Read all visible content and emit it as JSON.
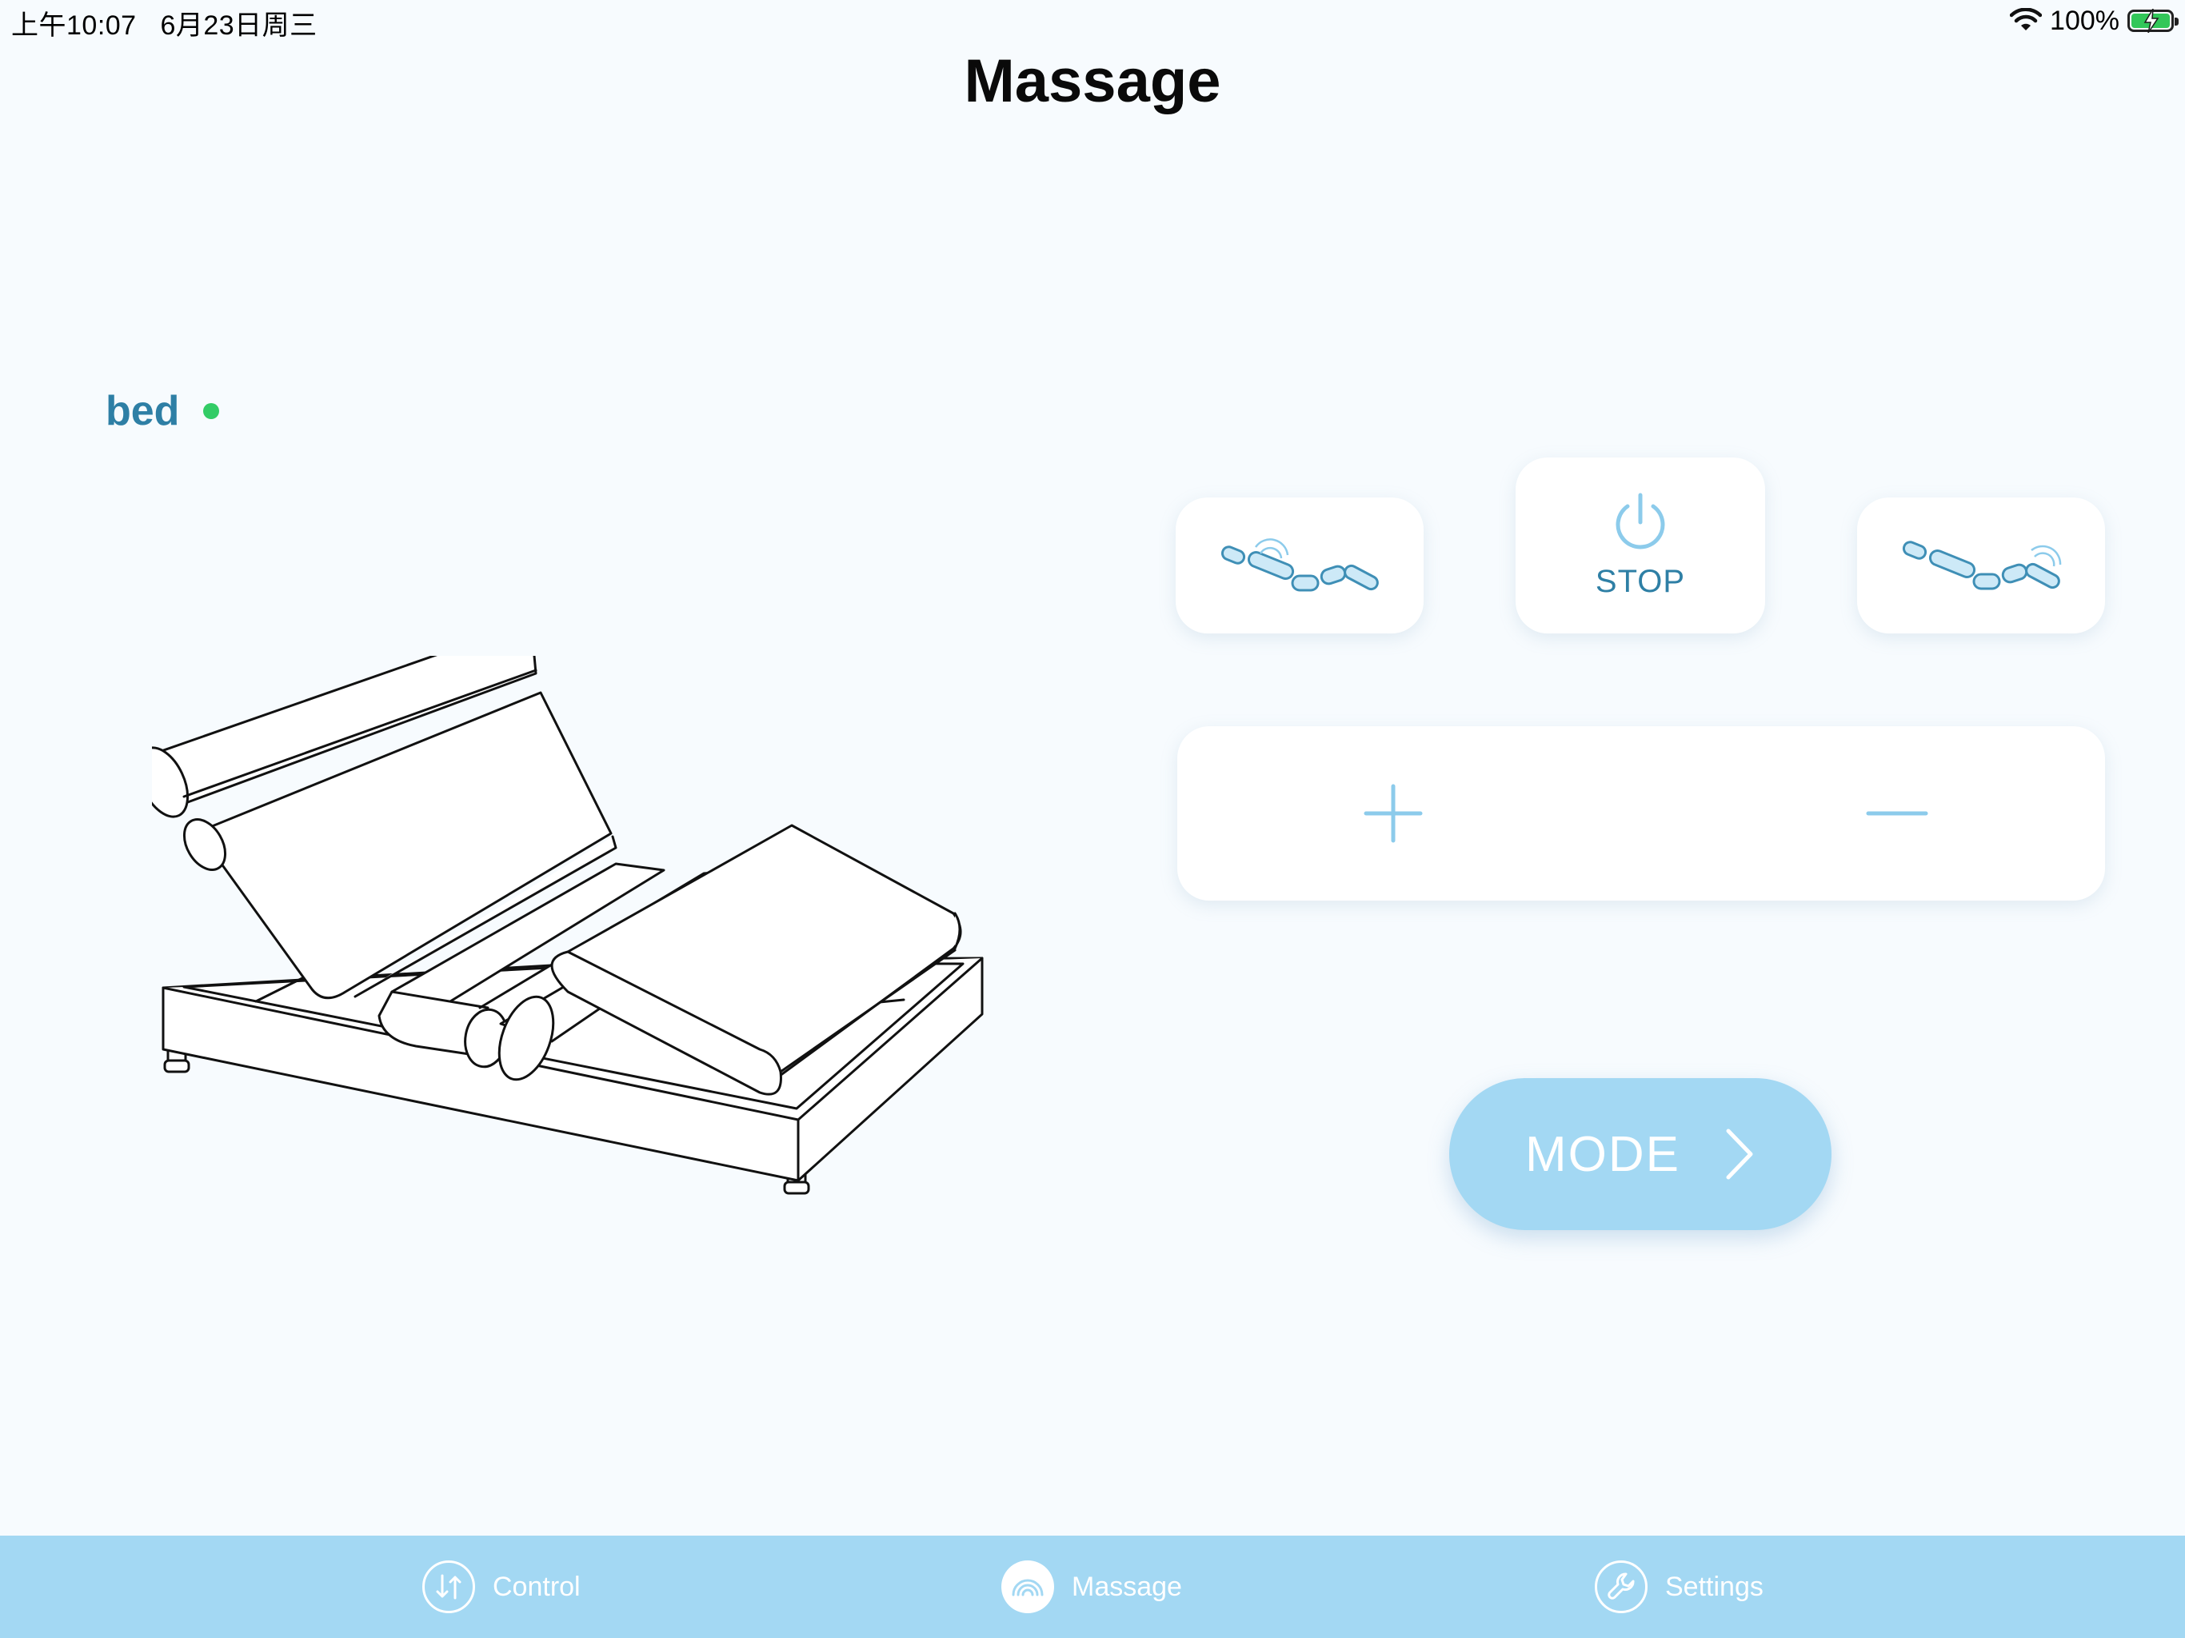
{
  "status_bar": {
    "time": "上午10:07",
    "date": "6月23日周三",
    "battery_percent": "100%",
    "battery_level": 1.0
  },
  "page": {
    "title": "Massage"
  },
  "device": {
    "name": "bed",
    "status_color": "#33cc66"
  },
  "controls": {
    "stop_label": "STOP",
    "mode_label": "MODE"
  },
  "tabs": [
    {
      "label": "Control",
      "icon": "control-icon",
      "active": false
    },
    {
      "label": "Massage",
      "icon": "massage-icon",
      "active": true
    },
    {
      "label": "Settings",
      "icon": "wrench-icon",
      "active": false
    }
  ],
  "colors": {
    "accent": "#a3d8f3",
    "text_blue": "#2e7fa5",
    "icon_blue": "#8ccbeb",
    "background": "#f7fbfe"
  }
}
